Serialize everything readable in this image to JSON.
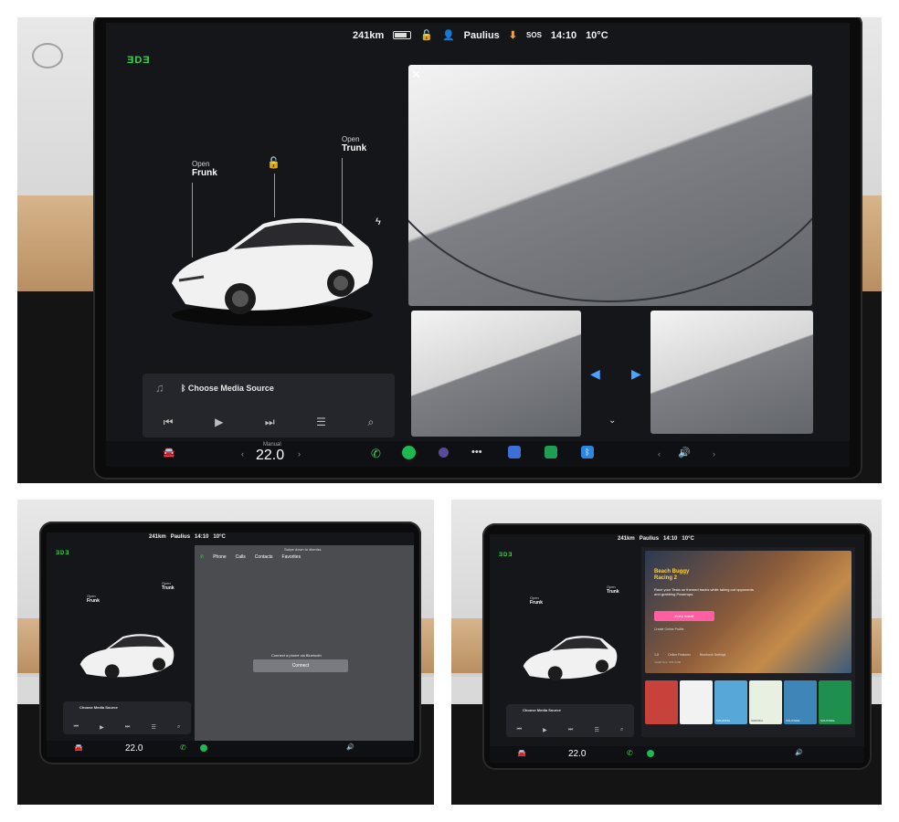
{
  "status": {
    "range": "241km",
    "user": "Paulius",
    "time": "14:10",
    "temp": "10°C",
    "sos": "SOS"
  },
  "brand": "ƎDƎ",
  "car": {
    "frunk": {
      "top": "Open",
      "main": "Frunk"
    },
    "trunk": {
      "top": "Open",
      "main": "Trunk"
    }
  },
  "media": {
    "source_label": "Choose Media Source"
  },
  "climate": {
    "mode": "Manual",
    "temperature": "22.0"
  },
  "phone": {
    "title": "Phone",
    "tabs": [
      "Calls",
      "Contacts",
      "Favorites"
    ],
    "hint": "Swipe down to dismiss",
    "connect_message": "Connect a phone via Bluetooth",
    "connect_button": "Connect"
  },
  "game": {
    "title_line1": "Beach Buggy",
    "title_line2": "Racing 2",
    "description": "Race your Tesla on themed tracks while taking out opponents and grabbing Powerups.",
    "install_button": "Entry Install",
    "profile_link": "Create Online Profile",
    "players": "1-8",
    "online": "Online Features",
    "bluetooth": "Bluetooth Settings",
    "install_size": "Install Size: 978.3 MB",
    "tile_labels": [
      "",
      "",
      "MAHJONG",
      "SUDOKU",
      "SOLITAIRE",
      "SOLITAIRE"
    ],
    "tile_colors": [
      "#c6423b",
      "#f2f2f2",
      "#57a8d8",
      "#e8f0e2",
      "#3e86b8",
      "#1f8f4e"
    ]
  },
  "icons": {
    "car": "car-icon",
    "phone": "phone-icon",
    "spotify": "spotify-icon",
    "camera": "camera-icon",
    "more": "more-icon",
    "navigation": "navigation-icon",
    "stocks": "stocks-icon",
    "bluetooth": "bluetooth-icon",
    "volume": "volume-icon"
  },
  "colors": {
    "accent_green": "#39d353",
    "pink": "#ff5fa2",
    "screen_bg": "#15161a"
  }
}
